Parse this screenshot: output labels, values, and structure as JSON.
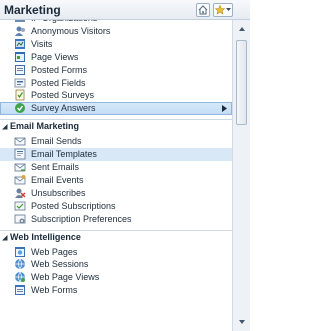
{
  "header": {
    "title": "Marketing",
    "home_icon": "home-icon",
    "favorites_icon": "favorites-star-icon"
  },
  "groups": [
    {
      "items": [
        {
          "label": "IP Organizations",
          "icon": "org-icon"
        },
        {
          "label": "Anonymous Visitors",
          "icon": "visitor-icon"
        },
        {
          "label": "Visits",
          "icon": "visits-icon"
        },
        {
          "label": "Page Views",
          "icon": "page-views-icon"
        },
        {
          "label": "Posted Forms",
          "icon": "posted-forms-icon"
        },
        {
          "label": "Posted Fields",
          "icon": "posted-fields-icon"
        },
        {
          "label": "Posted Surveys",
          "icon": "posted-surveys-icon"
        },
        {
          "label": "Survey Answers",
          "icon": "survey-answers-icon",
          "selected": true
        }
      ]
    },
    {
      "title": "Email Marketing",
      "items": [
        {
          "label": "Email Sends",
          "icon": "email-sends-icon"
        },
        {
          "label": "Email Templates",
          "icon": "email-templates-icon",
          "highlighted": true
        },
        {
          "label": "Sent Emails",
          "icon": "sent-emails-icon"
        },
        {
          "label": "Email Events",
          "icon": "email-events-icon"
        },
        {
          "label": "Unsubscribes",
          "icon": "unsubscribes-icon"
        },
        {
          "label": "Posted Subscriptions",
          "icon": "posted-subscriptions-icon"
        },
        {
          "label": "Subscription Preferences",
          "icon": "subscription-preferences-icon"
        }
      ]
    },
    {
      "title": "Web Intelligence",
      "items": [
        {
          "label": "Web Pages",
          "icon": "web-pages-icon"
        },
        {
          "label": "Web Sessions",
          "icon": "web-sessions-icon"
        },
        {
          "label": "Web Page Views",
          "icon": "web-page-views-icon"
        },
        {
          "label": "Web Forms",
          "icon": "web-forms-icon"
        }
      ]
    }
  ],
  "colors": {
    "selected_bg": "#c9e1f6",
    "highlight_bg": "#d8e8f7",
    "header_bg": "#e9eef4"
  }
}
